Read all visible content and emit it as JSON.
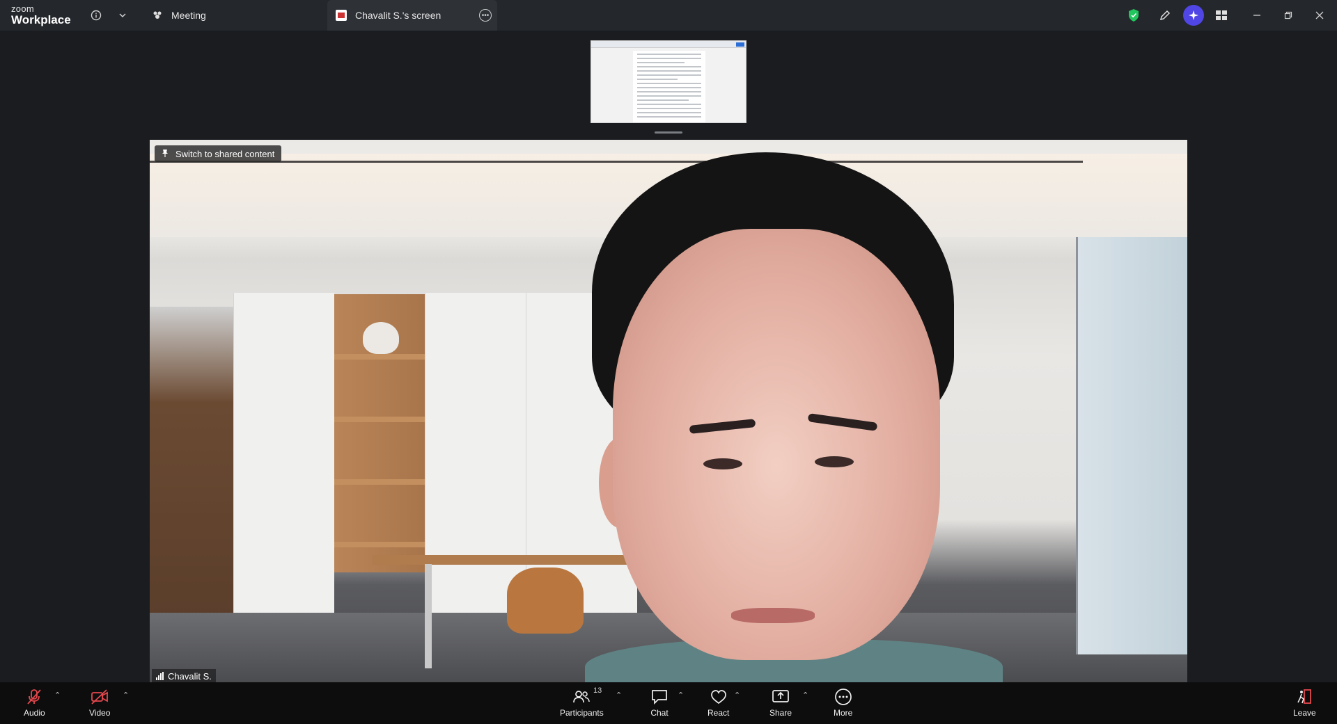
{
  "app": {
    "logo_top": "zoom",
    "logo_bottom": "Workplace"
  },
  "tabs": {
    "meeting": "Meeting",
    "screen": "Chavalit S.'s screen"
  },
  "video": {
    "switch_label": "Switch to shared content",
    "participant_name": "Chavalit S."
  },
  "toolbar": {
    "audio": "Audio",
    "video": "Video",
    "participants": "Participants",
    "participant_count": "13",
    "chat": "Chat",
    "react": "React",
    "share": "Share",
    "more": "More",
    "leave": "Leave"
  },
  "colors": {
    "security_shield": "#22c55e",
    "ai_companion": "#4f46e5",
    "leave_icon": "#e5484d",
    "muted_red": "#e5484d"
  }
}
